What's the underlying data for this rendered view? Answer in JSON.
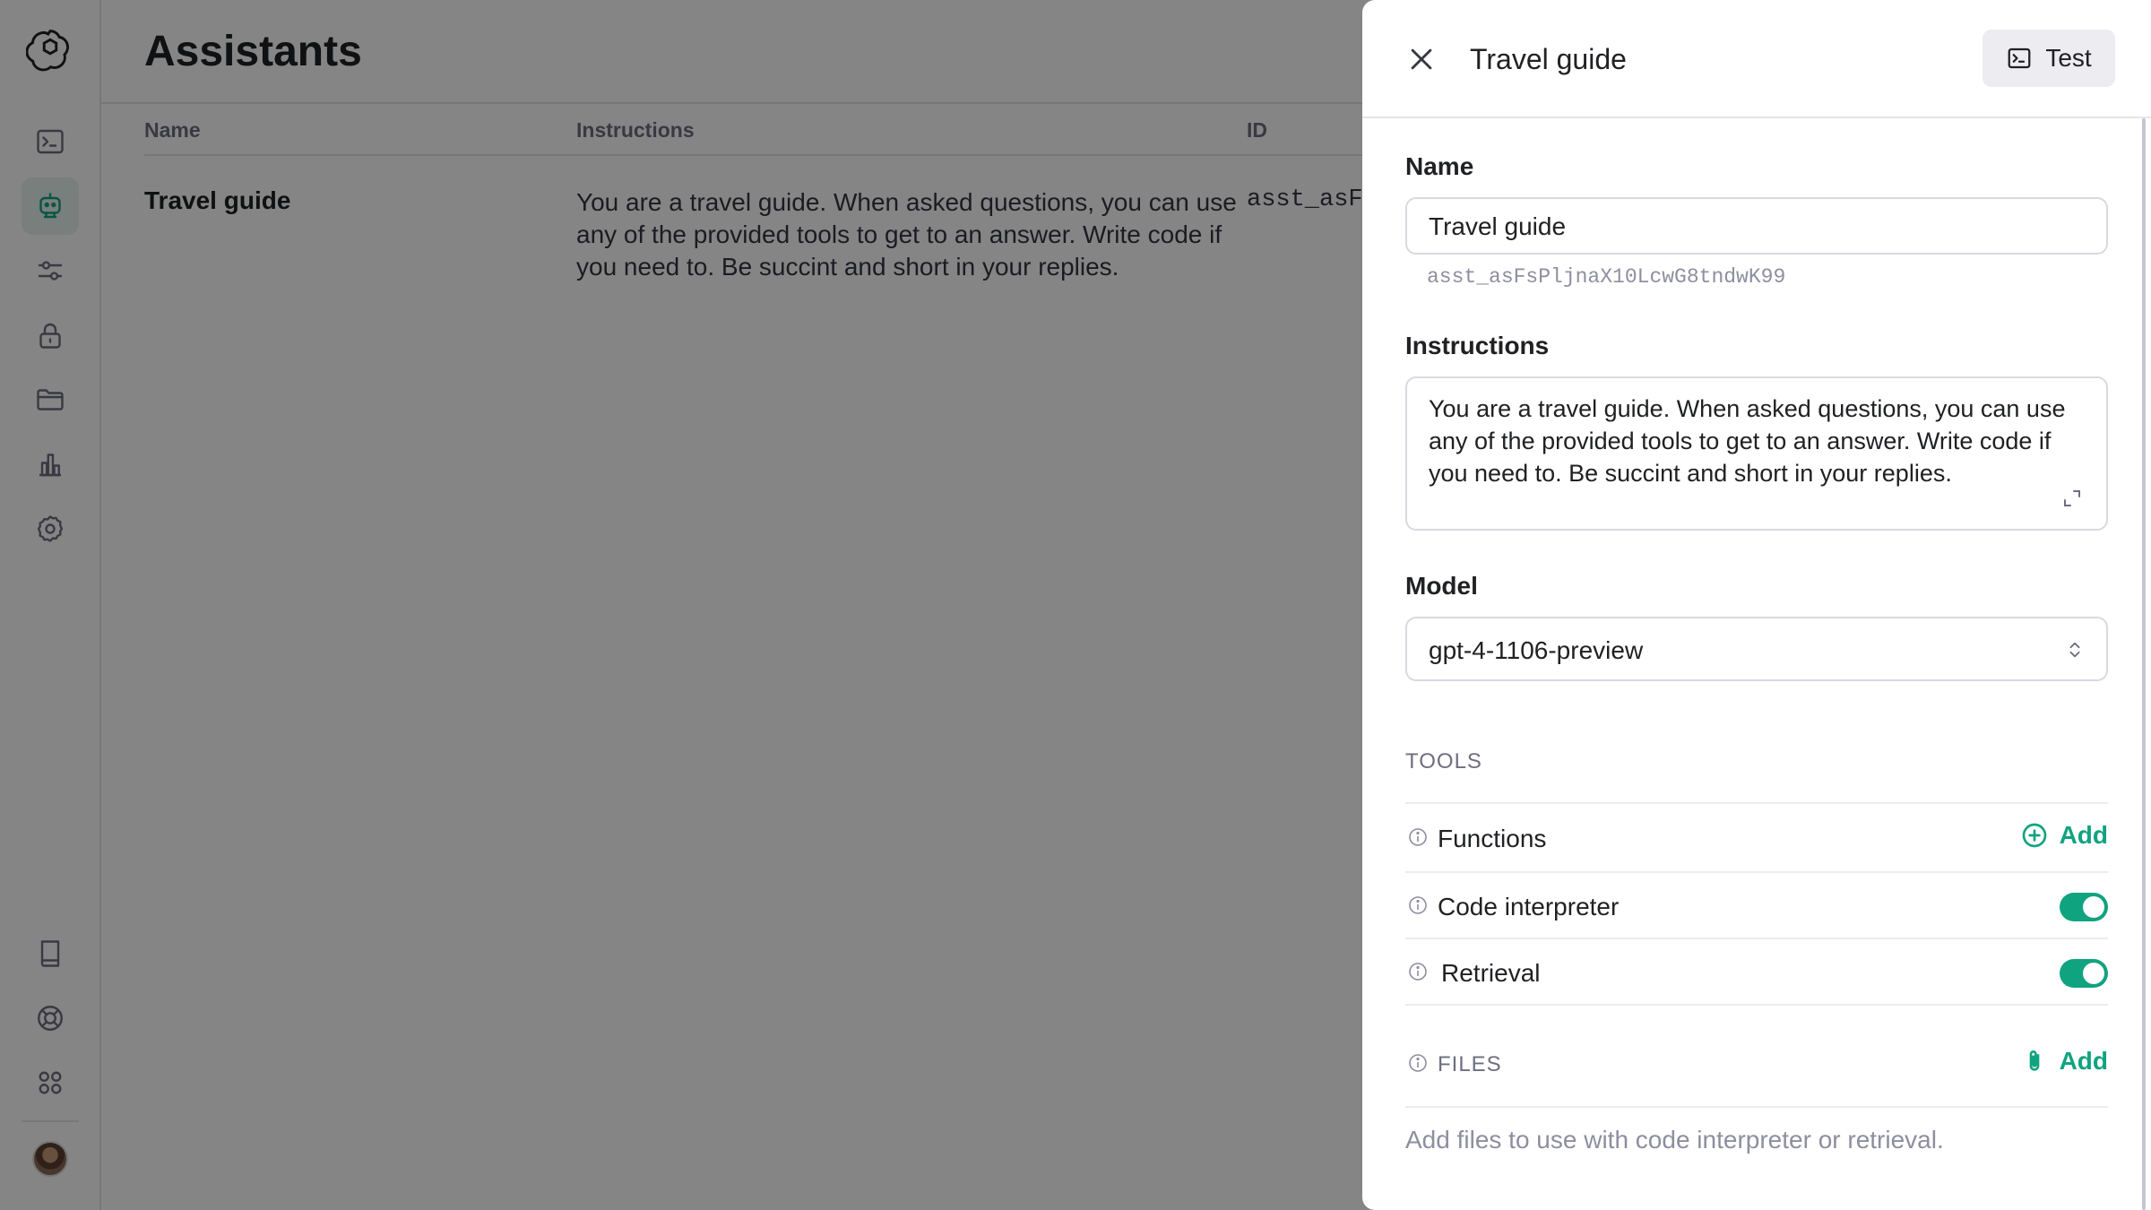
{
  "sidebar": {
    "logo": "openai-logo",
    "items": [
      {
        "icon": "terminal-icon",
        "label": "Playground"
      },
      {
        "icon": "robot-icon",
        "label": "Assistants",
        "active": true
      },
      {
        "icon": "sliders-icon",
        "label": "Fine-tuning"
      },
      {
        "icon": "lock-icon",
        "label": "API keys"
      },
      {
        "icon": "folder-icon",
        "label": "Files"
      },
      {
        "icon": "bar-chart-icon",
        "label": "Usage"
      },
      {
        "icon": "gear-icon",
        "label": "Settings"
      }
    ],
    "bottom_items": [
      {
        "icon": "book-icon",
        "label": "Documentation"
      },
      {
        "icon": "lifebuoy-icon",
        "label": "Help"
      },
      {
        "icon": "grid-icon",
        "label": "Apps"
      }
    ]
  },
  "main": {
    "title": "Assistants",
    "columns": [
      "Name",
      "Instructions",
      "ID"
    ],
    "rows": [
      {
        "name": "Travel guide",
        "instructions": "You are a travel guide. When asked questions, you can use any of the provided tools to get to an answer. Write code if you need to. Be succint and short in your replies.",
        "id": "asst_asF"
      }
    ]
  },
  "panel": {
    "title": "Travel guide",
    "test_label": "Test",
    "name_label": "Name",
    "name_value": "Travel guide",
    "assistant_id": "asst_asFsPljnaX10LcwG8tndwK99",
    "instructions_label": "Instructions",
    "instructions_value": "You are a travel guide. When asked questions, you can use any of the provided tools to get to an answer. Write code if you need to. Be succint and short in your replies.",
    "model_label": "Model",
    "model_value": "gpt-4-1106-preview",
    "tools_title": "TOOLS",
    "tools": {
      "functions_label": "Functions",
      "functions_add": "Add",
      "code_interpreter_label": "Code interpreter",
      "code_interpreter_enabled": true,
      "retrieval_label": "Retrieval",
      "retrieval_enabled": true
    },
    "files_title": "FILES",
    "files_add": "Add",
    "files_hint": "Add files to use with code interpreter or retrieval."
  },
  "colors": {
    "accent": "#10a37f",
    "overlay": "rgba(0,0,0,0.48)"
  }
}
